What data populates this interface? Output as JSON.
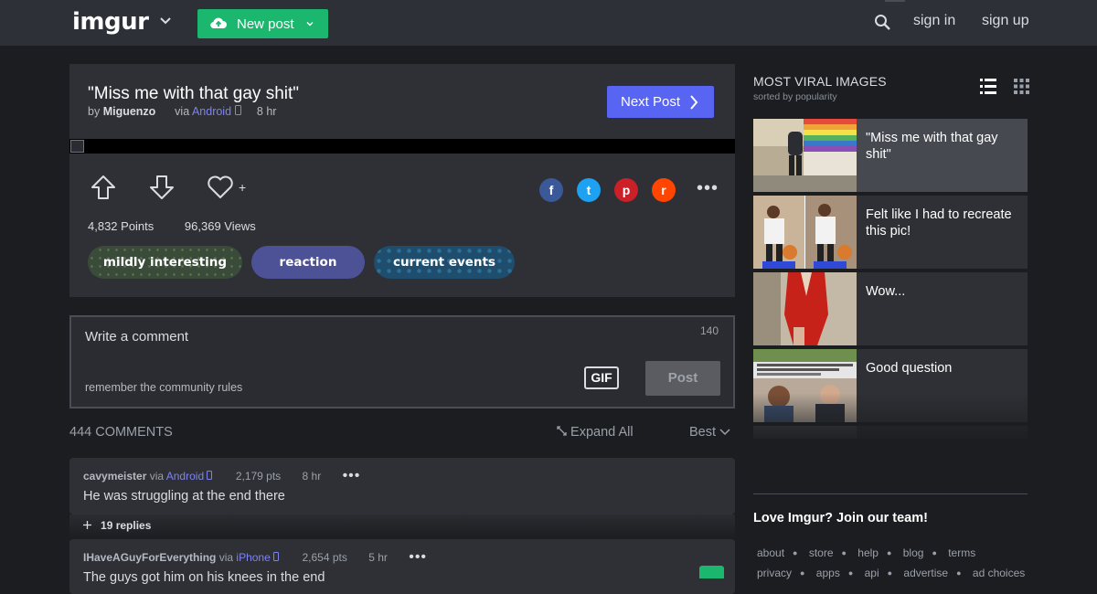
{
  "header": {
    "logo": "imgur",
    "new_post_label": "New post",
    "sign_in": "sign in",
    "sign_up": "sign up"
  },
  "post": {
    "title": "\"Miss me with that gay shit\"",
    "by_prefix": "by",
    "author": "Miguenzo",
    "via_prefix": "via",
    "via_platform": "Android",
    "age": "8 hr",
    "next_label": "Next Post",
    "favorite_plus": "+",
    "points": "4,832 Points",
    "views": "96,369 Views",
    "tags": [
      "mildly interesting",
      "reaction",
      "current events"
    ]
  },
  "share": {
    "facebook": "f",
    "twitter": "t",
    "pinterest": "p",
    "reddit": "r"
  },
  "comment_form": {
    "placeholder": "Write a comment",
    "char_limit": "140",
    "rules": "remember the community rules",
    "gif_label": "GIF",
    "post_label": "Post"
  },
  "comments_bar": {
    "count": "444 COMMENTS",
    "expand_all": "Expand All",
    "sort": "Best"
  },
  "comments": [
    {
      "author": "cavymeister",
      "via_prefix": "via",
      "platform": "Android",
      "points": "2,179 pts",
      "age": "8 hr",
      "text": "He was struggling at the end there",
      "replies_count": "19 replies"
    },
    {
      "author": "IHaveAGuyForEverything",
      "via_prefix": "via",
      "platform": "iPhone",
      "points": "2,654 pts",
      "age": "5 hr",
      "text": "The guys got him on his knees in the end"
    }
  ],
  "sidebar": {
    "title": "MOST VIRAL IMAGES",
    "subtitle": "sorted by popularity",
    "items": [
      {
        "title": "\"Miss me with that gay shit\""
      },
      {
        "title": "Felt like I had to recreate this pic!"
      },
      {
        "title": "Wow..."
      },
      {
        "title": "Good question"
      }
    ],
    "join": "Love Imgur? Join our team!",
    "footer_row1": [
      "about",
      "store",
      "help",
      "blog",
      "terms"
    ],
    "footer_row2": [
      "privacy",
      "apps",
      "api",
      "advertise",
      "ad choices"
    ]
  },
  "colors": {
    "accent_green": "#1bb76e",
    "accent_blue": "#5865f2",
    "background": "#1b1d20",
    "card": "#2e3035"
  }
}
